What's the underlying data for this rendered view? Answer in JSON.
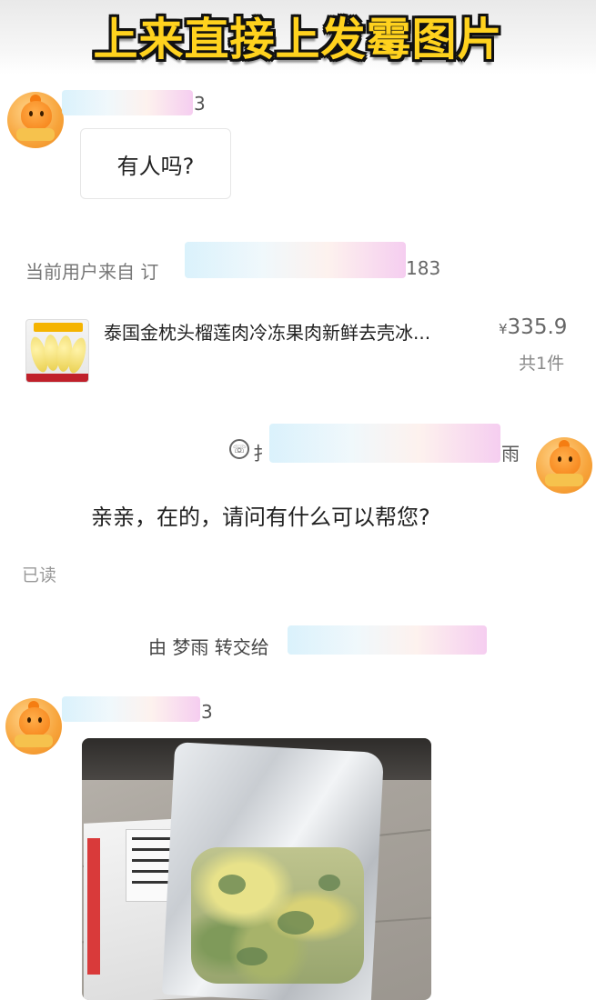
{
  "banner": {
    "title": "上来直接上发霉图片"
  },
  "messages": {
    "first": {
      "name_suffix": "3",
      "text": "有人吗?"
    },
    "source": {
      "prefix": "当前用户来自 订",
      "suffix": "183"
    },
    "product": {
      "title": "泰国金枕头榴莲肉冷冻果肉新鲜去壳冰...",
      "currency": "¥",
      "price": "335.9",
      "count": "共1件"
    },
    "seller": {
      "name_prefix": "扌",
      "name_suffix": "雨",
      "reply": "亲亲，在的，请问有什么可以帮您?",
      "read": "已读"
    },
    "transfer": {
      "text": "由 梦雨 转交给"
    },
    "second": {
      "name_suffix": "3"
    }
  },
  "icons": {
    "avatar": "orange-mascot-avatar",
    "call": "phone-icon"
  },
  "colors": {
    "banner_text": "#ffd21e",
    "banner_outline": "#111111"
  }
}
